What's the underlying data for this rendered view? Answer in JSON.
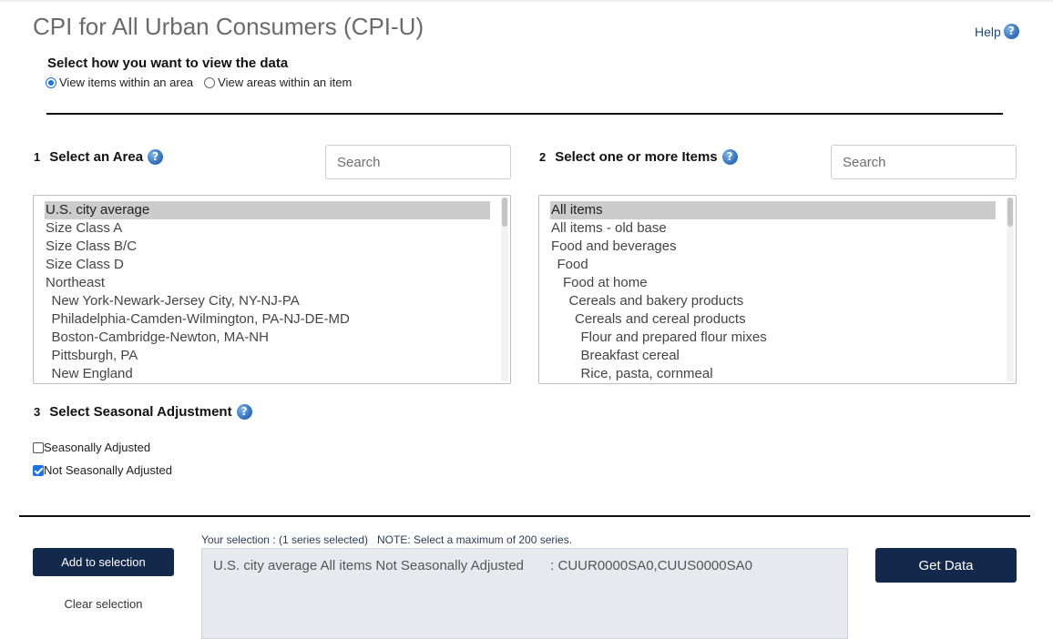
{
  "page": {
    "title": "CPI for All Urban Consumers (CPI-U)",
    "help_label": "Help",
    "help_icon": "?"
  },
  "view_options": {
    "heading": "Select how you want to view the data",
    "option1": "View items within an area",
    "option2": "View areas within an item",
    "selected": "option1"
  },
  "area": {
    "number": "1",
    "heading": "Select an Area",
    "search_placeholder": "Search",
    "items": [
      "U.S. city average",
      "Size Class A",
      "Size Class B/C",
      "Size Class D",
      "Northeast",
      "New York-Newark-Jersey City, NY-NJ-PA",
      "Philadelphia-Camden-Wilmington, PA-NJ-DE-MD",
      "Boston-Cambridge-Newton, MA-NH",
      "Pittsburgh, PA",
      "New England"
    ],
    "selected_index": 0
  },
  "items": {
    "number": "2",
    "heading": "Select one or more Items",
    "search_placeholder": "Search",
    "items": [
      "All items",
      "All items - old base",
      "Food and beverages",
      "Food",
      "Food at home",
      "Cereals and bakery products",
      "Cereals and cereal products",
      "Flour and prepared flour mixes",
      "Breakfast cereal",
      "Rice, pasta, cornmeal"
    ],
    "selected_index": 0
  },
  "seasonal": {
    "number": "3",
    "heading": "Select Seasonal Adjustment",
    "option1": "Seasonally Adjusted",
    "option1_checked": false,
    "option2": "Not Seasonally Adjusted",
    "option2_checked": true
  },
  "selection": {
    "summary": "Your selection : (1 series selected)   NOTE: Select a maximum of 200 series.",
    "add_label": "Add to selection",
    "clear_label": "Clear selection",
    "entries": [
      "U.S. city average All items Not Seasonally Adjusted       : CUUR0000SA0,CUUS0000SA0"
    ],
    "get_data_label": "Get Data"
  },
  "colors": {
    "button_bg": "#13294b",
    "selected_row": "#cccccc",
    "selection_box": "#e6e9ed"
  }
}
